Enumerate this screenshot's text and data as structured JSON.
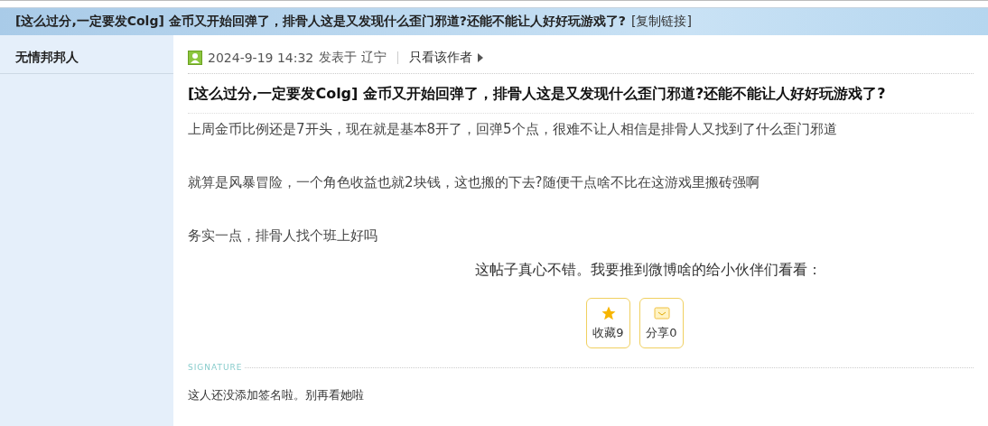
{
  "thread": {
    "title": "[这么过分,一定要发Colg] 金币又开始回弹了，排骨人这是又发现什么歪门邪道?还能不能让人好好玩游戏了?",
    "copy_link": "[复制链接]"
  },
  "author": {
    "name": "无情邦邦人"
  },
  "post": {
    "date": "2024-9-19 14:32",
    "posted_in": "发表于 辽宁",
    "only_author": "只看该作者",
    "title": "[这么过分,一定要发Colg] 金币又开始回弹了，排骨人这是又发现什么歪门邪道?还能不能让人好好玩游戏了?",
    "paragraphs": [
      "上周金币比例还是7开头，现在就是基本8开了，回弹5个点，很难不让人相信是排骨人又找到了什么歪门邪道",
      "就算是风暴冒险，一个角色收益也就2块钱，这也搬的下去?随便干点啥不比在这游戏里搬砖强啊",
      "务实一点，排骨人找个班上好吗"
    ],
    "share_prompt": "这帖子真心不错。我要推到微博啥的给小伙伴们看看：",
    "actions": [
      {
        "kind": "favorite",
        "label": "收藏9"
      },
      {
        "kind": "share",
        "label": "分享0"
      }
    ]
  },
  "signature": {
    "label": "SIGNATURE",
    "text": "这人还没添加签名啦。别再看她啦"
  }
}
